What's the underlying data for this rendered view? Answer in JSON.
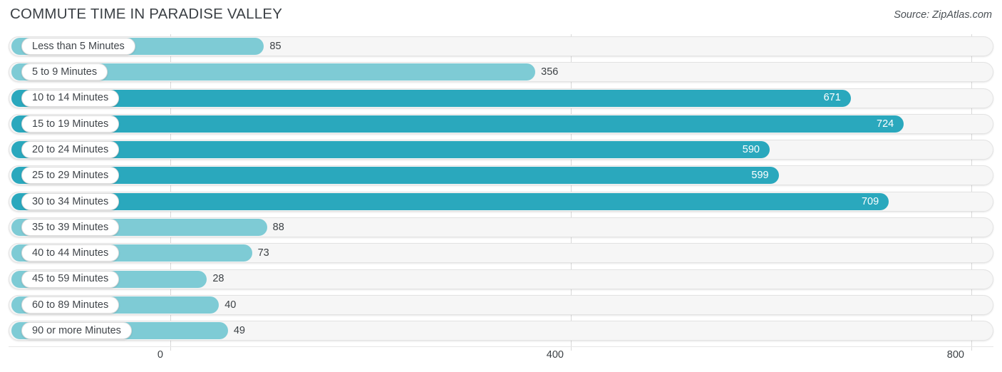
{
  "header": {
    "title": "COMMUTE TIME IN PARADISE VALLEY",
    "source": "Source: ZipAtlas.com"
  },
  "colors": {
    "bar_light": "#7ecbd5",
    "bar_dark": "#2aa8bd",
    "track": "#f6f6f6",
    "track_border": "#e3e3e3",
    "gridline": "#d9d9d9",
    "text": "#3c4145",
    "value_inside": "#ffffff"
  },
  "chart_data": {
    "type": "bar",
    "orientation": "horizontal",
    "title": "COMMUTE TIME IN PARADISE VALLEY",
    "subtitle": "",
    "xlabel": "",
    "ylabel": "",
    "source": "Source: ZipAtlas.com",
    "grid": true,
    "legend": null,
    "xlim": [
      0,
      800
    ],
    "xticks": [
      0,
      400,
      800
    ],
    "xtick_labels": [
      "0",
      "400",
      "800"
    ],
    "categories": [
      "Less than 5 Minutes",
      "5 to 9 Minutes",
      "10 to 14 Minutes",
      "15 to 19 Minutes",
      "20 to 24 Minutes",
      "25 to 29 Minutes",
      "30 to 34 Minutes",
      "35 to 39 Minutes",
      "40 to 44 Minutes",
      "45 to 59 Minutes",
      "60 to 89 Minutes",
      "90 or more Minutes"
    ],
    "values": [
      85,
      356,
      671,
      724,
      590,
      599,
      709,
      88,
      73,
      28,
      40,
      49
    ],
    "value_labels": [
      "85",
      "356",
      "671",
      "724",
      "590",
      "599",
      "709",
      "88",
      "73",
      "28",
      "40",
      "49"
    ]
  },
  "rows": [
    {
      "label": "Less than 5 Minutes",
      "value": 85,
      "value_label": "85",
      "shade": "light",
      "label_inside": true
    },
    {
      "label": "5 to 9 Minutes",
      "value": 356,
      "value_label": "356",
      "shade": "light",
      "label_inside": true
    },
    {
      "label": "10 to 14 Minutes",
      "value": 671,
      "value_label": "671",
      "shade": "dark",
      "label_inside": false
    },
    {
      "label": "15 to 19 Minutes",
      "value": 724,
      "value_label": "724",
      "shade": "dark",
      "label_inside": false
    },
    {
      "label": "20 to 24 Minutes",
      "value": 590,
      "value_label": "590",
      "shade": "dark",
      "label_inside": false
    },
    {
      "label": "25 to 29 Minutes",
      "value": 599,
      "value_label": "599",
      "shade": "dark",
      "label_inside": false
    },
    {
      "label": "30 to 34 Minutes",
      "value": 709,
      "value_label": "709",
      "shade": "dark",
      "label_inside": false
    },
    {
      "label": "35 to 39 Minutes",
      "value": 88,
      "value_label": "88",
      "shade": "light",
      "label_inside": true
    },
    {
      "label": "40 to 44 Minutes",
      "value": 73,
      "value_label": "73",
      "shade": "light",
      "label_inside": true
    },
    {
      "label": "45 to 59 Minutes",
      "value": 28,
      "value_label": "28",
      "shade": "light",
      "label_inside": true
    },
    {
      "label": "60 to 89 Minutes",
      "value": 40,
      "value_label": "40",
      "shade": "light",
      "label_inside": true
    },
    {
      "label": "90 or more Minutes",
      "value": 49,
      "value_label": "49",
      "shade": "light",
      "label_inside": true
    }
  ],
  "axis": {
    "ticks": [
      {
        "label": "0",
        "value": 0
      },
      {
        "label": "400",
        "value": 400
      },
      {
        "label": "800",
        "value": 800
      }
    ]
  }
}
